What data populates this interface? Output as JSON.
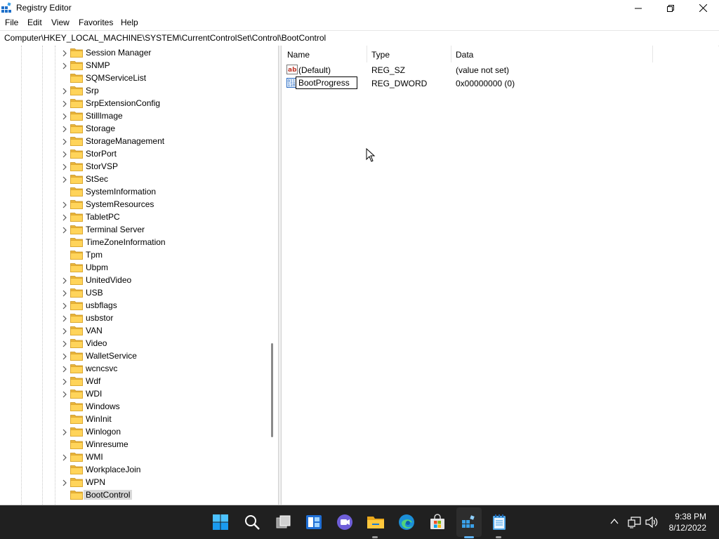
{
  "window": {
    "title": "Registry Editor",
    "menu": [
      "File",
      "Edit",
      "View",
      "Favorites",
      "Help"
    ],
    "address": "Computer\\HKEY_LOCAL_MACHINE\\SYSTEM\\CurrentControlSet\\Control\\BootControl"
  },
  "tree": {
    "items": [
      {
        "label": "Session Manager",
        "expandable": true
      },
      {
        "label": "SNMP",
        "expandable": true
      },
      {
        "label": "SQMServiceList",
        "expandable": false
      },
      {
        "label": "Srp",
        "expandable": true
      },
      {
        "label": "SrpExtensionConfig",
        "expandable": true
      },
      {
        "label": "StillImage",
        "expandable": true
      },
      {
        "label": "Storage",
        "expandable": true
      },
      {
        "label": "StorageManagement",
        "expandable": true
      },
      {
        "label": "StorPort",
        "expandable": true
      },
      {
        "label": "StorVSP",
        "expandable": true
      },
      {
        "label": "StSec",
        "expandable": true
      },
      {
        "label": "SystemInformation",
        "expandable": false
      },
      {
        "label": "SystemResources",
        "expandable": true
      },
      {
        "label": "TabletPC",
        "expandable": true
      },
      {
        "label": "Terminal Server",
        "expandable": true
      },
      {
        "label": "TimeZoneInformation",
        "expandable": false
      },
      {
        "label": "Tpm",
        "expandable": false
      },
      {
        "label": "Ubpm",
        "expandable": false
      },
      {
        "label": "UnitedVideo",
        "expandable": true
      },
      {
        "label": "USB",
        "expandable": true
      },
      {
        "label": "usbflags",
        "expandable": true
      },
      {
        "label": "usbstor",
        "expandable": true
      },
      {
        "label": "VAN",
        "expandable": true
      },
      {
        "label": "Video",
        "expandable": true
      },
      {
        "label": "WalletService",
        "expandable": true
      },
      {
        "label": "wcncsvc",
        "expandable": true
      },
      {
        "label": "Wdf",
        "expandable": true
      },
      {
        "label": "WDI",
        "expandable": true
      },
      {
        "label": "Windows",
        "expandable": false
      },
      {
        "label": "WinInit",
        "expandable": false
      },
      {
        "label": "Winlogon",
        "expandable": true
      },
      {
        "label": "Winresume",
        "expandable": false
      },
      {
        "label": "WMI",
        "expandable": true
      },
      {
        "label": "WorkplaceJoin",
        "expandable": false
      },
      {
        "label": "WPN",
        "expandable": true
      },
      {
        "label": "BootControl",
        "expandable": false,
        "selected": true
      }
    ]
  },
  "values": {
    "columns": [
      "Name",
      "Type",
      "Data"
    ],
    "rows": [
      {
        "name": "(Default)",
        "type": "REG_SZ",
        "data": "(value not set)",
        "icon": "string-value-icon"
      },
      {
        "name": "BootProgress",
        "type": "REG_DWORD",
        "data": "0x00000000 (0)",
        "icon": "dword-value-icon",
        "editing": true
      }
    ]
  },
  "taskbar": {
    "time": "9:38 PM",
    "date": "8/12/2022"
  }
}
